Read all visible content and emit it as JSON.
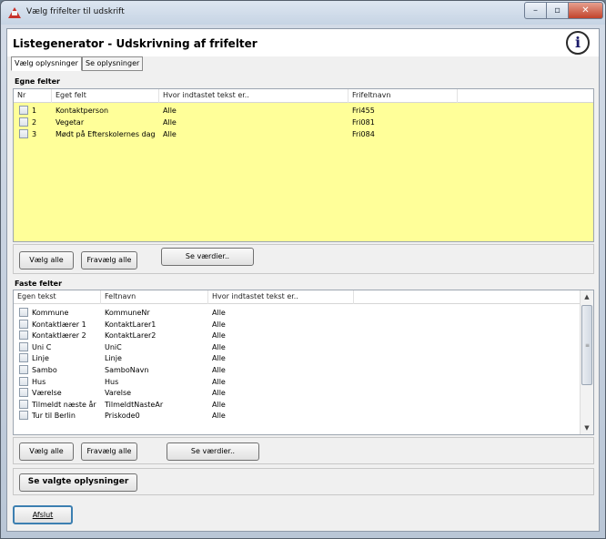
{
  "window": {
    "title": "Vælg frifelter til udskrift",
    "minimize_glyph": "–",
    "maximize_glyph": "▫",
    "close_glyph": "✕"
  },
  "header": {
    "title": "Listegenerator - Udskrivning af frifelter",
    "info_glyph": "i"
  },
  "tabs": [
    {
      "label": "Vælg oplysninger",
      "active": true
    },
    {
      "label": "Se oplysninger",
      "active": false
    }
  ],
  "egne_felter": {
    "label": "Egne felter",
    "columns": [
      "Nr",
      "Eget felt",
      "Hvor indtastet tekst er..",
      "Frifeltnavn"
    ],
    "rows": [
      {
        "nr": "1",
        "felt": "Kontaktperson",
        "hvor": "Alle",
        "navn": "Fri455"
      },
      {
        "nr": "2",
        "felt": "Vegetar",
        "hvor": "Alle",
        "navn": "Fri081"
      },
      {
        "nr": "3",
        "felt": "Mødt på Efterskolernes dag",
        "hvor": "Alle",
        "navn": "Fri084"
      }
    ],
    "background": "#ffff99",
    "select_all": "Vælg alle",
    "deselect_all": "Fravælg alle",
    "show_values": "Se værdier.."
  },
  "faste_felter": {
    "label": "Faste felter",
    "columns": [
      "Egen tekst",
      "Feltnavn",
      "Hvor indtastet tekst er.."
    ],
    "rows": [
      {
        "tekst": "Kommune",
        "felt": "KommuneNr",
        "hvor": "Alle"
      },
      {
        "tekst": "Kontaktlærer 1",
        "felt": "KontaktLarer1",
        "hvor": "Alle"
      },
      {
        "tekst": "Kontaktlærer 2",
        "felt": "KontaktLarer2",
        "hvor": "Alle"
      },
      {
        "tekst": "Uni C",
        "felt": "UniC",
        "hvor": "Alle"
      },
      {
        "tekst": "Linje",
        "felt": "Linje",
        "hvor": "Alle"
      },
      {
        "tekst": "Sambo",
        "felt": "SamboNavn",
        "hvor": "Alle"
      },
      {
        "tekst": "Hus",
        "felt": "Hus",
        "hvor": "Alle"
      },
      {
        "tekst": "Værelse",
        "felt": "Varelse",
        "hvor": "Alle"
      },
      {
        "tekst": "Tilmeldt næste år",
        "felt": "TilmeldtNasteAr",
        "hvor": "Alle"
      },
      {
        "tekst": "Tur til Berlin",
        "felt": "Priskode0",
        "hvor": "Alle"
      }
    ],
    "select_all": "Vælg alle",
    "deselect_all": "Fravælg alle",
    "show_values": "Se værdier..",
    "scroll_up_glyph": "▲",
    "scroll_down_glyph": "▼",
    "scroll_grip_glyph": "≡"
  },
  "actions": {
    "show_selected": "Se valgte oplysninger",
    "exit": "Afslut"
  }
}
